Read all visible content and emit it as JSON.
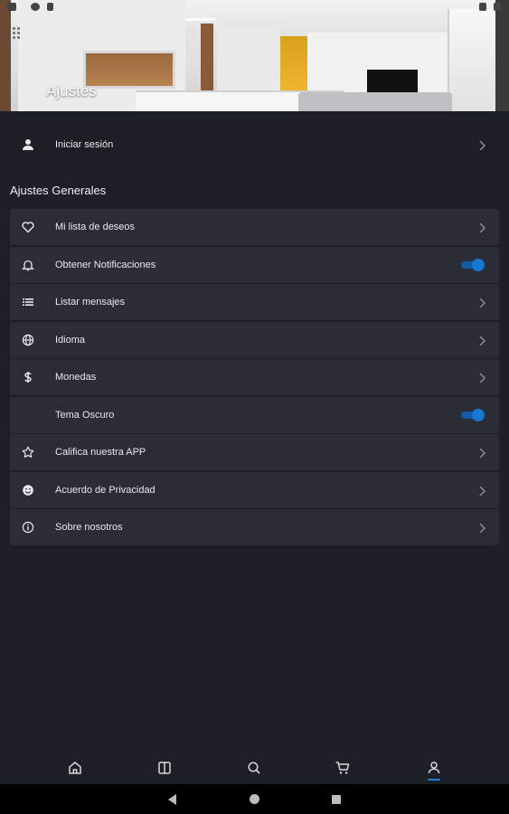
{
  "header": {
    "title": "Ajustes"
  },
  "login": {
    "label": "Iniciar sesión",
    "icon": "person-icon"
  },
  "section": {
    "title": "Ajustes Generales"
  },
  "items": [
    {
      "label": "Mi lista de deseos",
      "icon": "heart-icon",
      "control": "chevron"
    },
    {
      "label": "Obtener Notificaciones",
      "icon": "bell-icon",
      "control": "toggle",
      "on": true
    },
    {
      "label": "Listar mensajes",
      "icon": "list-icon",
      "control": "chevron"
    },
    {
      "label": "Idioma",
      "icon": "globe-icon",
      "control": "chevron"
    },
    {
      "label": "Monedas",
      "icon": "dollar-icon",
      "control": "chevron"
    },
    {
      "label": "Tema Oscuro",
      "icon": "moon-icon",
      "control": "toggle",
      "on": true
    },
    {
      "label": "Califica nuestra APP",
      "icon": "star-icon",
      "control": "chevron"
    },
    {
      "label": "Acuerdo de Privacidad",
      "icon": "smile-icon",
      "control": "chevron"
    },
    {
      "label": "Sobre nosotros",
      "icon": "info-icon",
      "control": "chevron"
    }
  ],
  "bottom_nav": [
    {
      "icon": "home-icon"
    },
    {
      "icon": "book-icon"
    },
    {
      "icon": "search-icon"
    },
    {
      "icon": "cart-icon"
    },
    {
      "icon": "profile-icon",
      "active": true
    }
  ],
  "colors": {
    "background": "#1d1f26",
    "card": "#2a2d36",
    "accent": "#1976d2"
  }
}
